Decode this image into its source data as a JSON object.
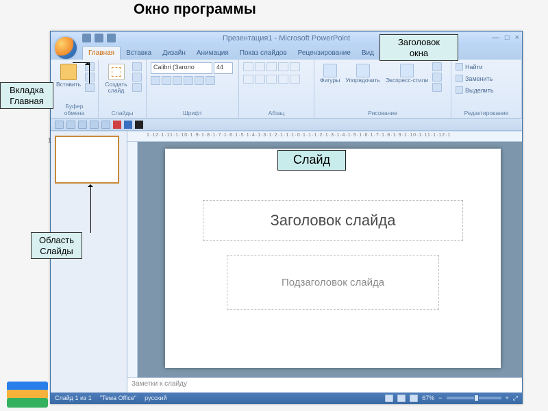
{
  "lecture": {
    "title": "Окно программы"
  },
  "callouts": {
    "title_bar": "Заголовок\nокна",
    "home_tab": "Вкладка\nГлавная",
    "slides_area": "Область\nСлайды",
    "slide": "Слайд"
  },
  "app": {
    "title": "Презентация1 - Microsoft PowerPoint",
    "tabs": [
      {
        "label": "Главная",
        "active": true
      },
      {
        "label": "Вставка"
      },
      {
        "label": "Дизайн"
      },
      {
        "label": "Анимация"
      },
      {
        "label": "Показ слайдов"
      },
      {
        "label": "Рецензирование"
      },
      {
        "label": "Вид"
      }
    ],
    "ribbon": {
      "clipboard": {
        "label": "Буфер обмена",
        "paste": "Вставить"
      },
      "slides": {
        "label": "Слайды",
        "new_slide": "Создать\nслайд"
      },
      "font": {
        "label": "Шрифт",
        "family": "Calibri (Заголо",
        "size": "44"
      },
      "paragraph": {
        "label": "Абзац"
      },
      "drawing": {
        "label": "Рисование",
        "shapes": "Фигуры",
        "arrange": "Упорядочить",
        "quick_styles": "Экспресс-стили"
      },
      "editing": {
        "label": "Редактирование",
        "find": "Найти",
        "replace": "Заменить",
        "select": "Выделить"
      }
    },
    "ruler_h": "1·12·1·11·1·10·1·9·1·8·1·7·1·6·1·5·1·4·1·3·1·2·1·1·1·0·1·1·1·2·1·3·1·4·1·5·1·6·1·7·1·8·1·9·1·10·1·11·1·12·1",
    "slide_content": {
      "title_ph": "Заголовок слайда",
      "subtitle_ph": "Подзаголовок слайда"
    },
    "notes_placeholder": "Заметки к слайду",
    "status": {
      "slide_count": "Слайд 1 из 1",
      "theme": "\"Тема Office\"",
      "lang": "русский",
      "zoom": "67%"
    },
    "thumb_number": "1"
  }
}
